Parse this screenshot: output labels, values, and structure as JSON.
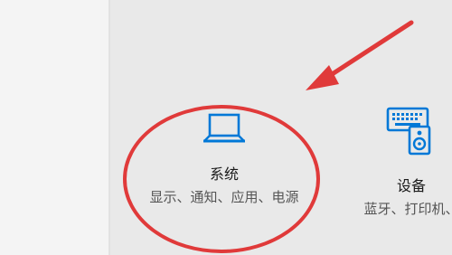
{
  "settings": {
    "categories": [
      {
        "title": "系统",
        "description": "显示、通知、应用、电源",
        "icon": "laptop-icon"
      },
      {
        "title": "设备",
        "description": "蓝牙、打印机、",
        "icon": "keyboard-speaker-icon"
      }
    ]
  },
  "annotation": {
    "color": "#e03a3a",
    "shapes": [
      "red-circle",
      "red-arrow"
    ]
  }
}
